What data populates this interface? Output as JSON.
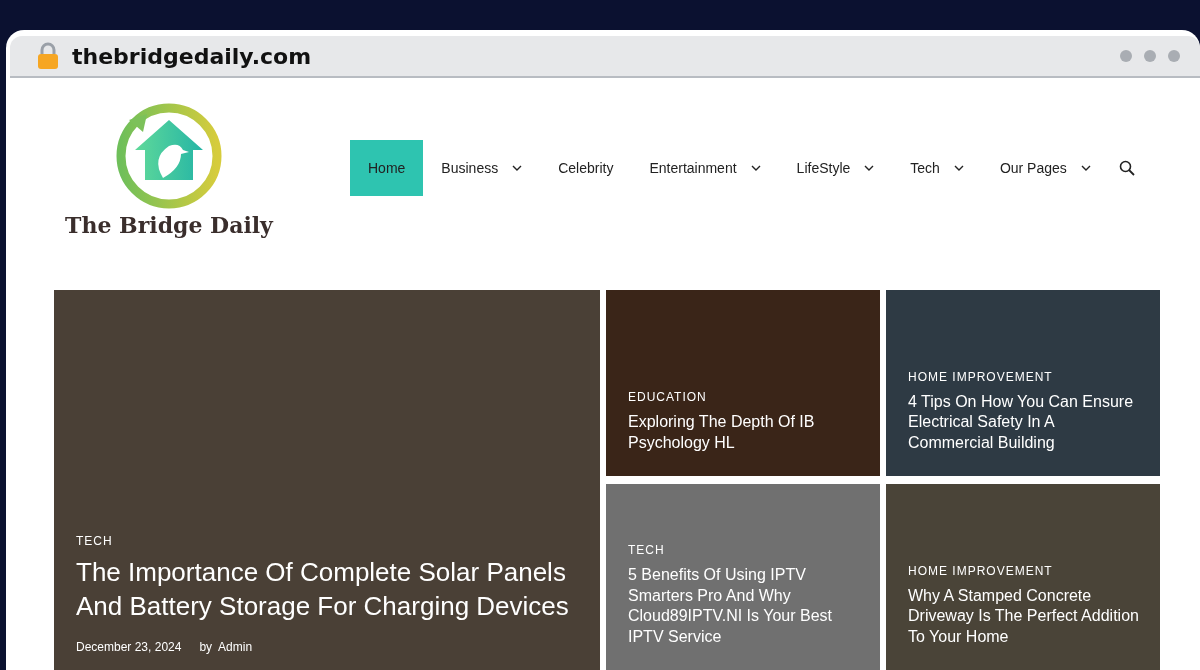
{
  "browser": {
    "url": "thebridgedaily.com"
  },
  "site": {
    "name": "The Bridge Daily"
  },
  "nav": [
    {
      "label": "Home",
      "selected": true,
      "has_menu": false
    },
    {
      "label": "Business",
      "selected": false,
      "has_menu": true
    },
    {
      "label": "Celebrity",
      "selected": false,
      "has_menu": false
    },
    {
      "label": "Entertainment",
      "selected": false,
      "has_menu": true
    },
    {
      "label": "LifeStyle",
      "selected": false,
      "has_menu": true
    },
    {
      "label": "Tech",
      "selected": false,
      "has_menu": true
    },
    {
      "label": "Our Pages",
      "selected": false,
      "has_menu": true
    }
  ],
  "featured": {
    "category": "TECH",
    "title": "The Importance Of Complete Solar Panels And Battery Storage For Charging Devices",
    "date": "December 23, 2024",
    "by": "by",
    "author": "Admin",
    "color": "#4a4036"
  },
  "posts": [
    {
      "category": "EDUCATION",
      "title": "Exploring The Depth Of IB Psychology HL",
      "color": "#3a2518"
    },
    {
      "category": "HOME IMPROVEMENT",
      "title": "4 Tips On How You Can Ensure Electrical Safety In A Commercial Building",
      "color": "#2e3a44"
    },
    {
      "category": "TECH",
      "title": "5 Benefits Of Using IPTV Smarters Pro And Why Cloud89IPTV.NI Is Your Best IPTV Service",
      "color": "#707070"
    },
    {
      "category": "HOME IMPROVEMENT",
      "title": "Why A Stamped Concrete Driveway Is The Perfect Addition To Your Home",
      "color": "#4a4438"
    }
  ]
}
